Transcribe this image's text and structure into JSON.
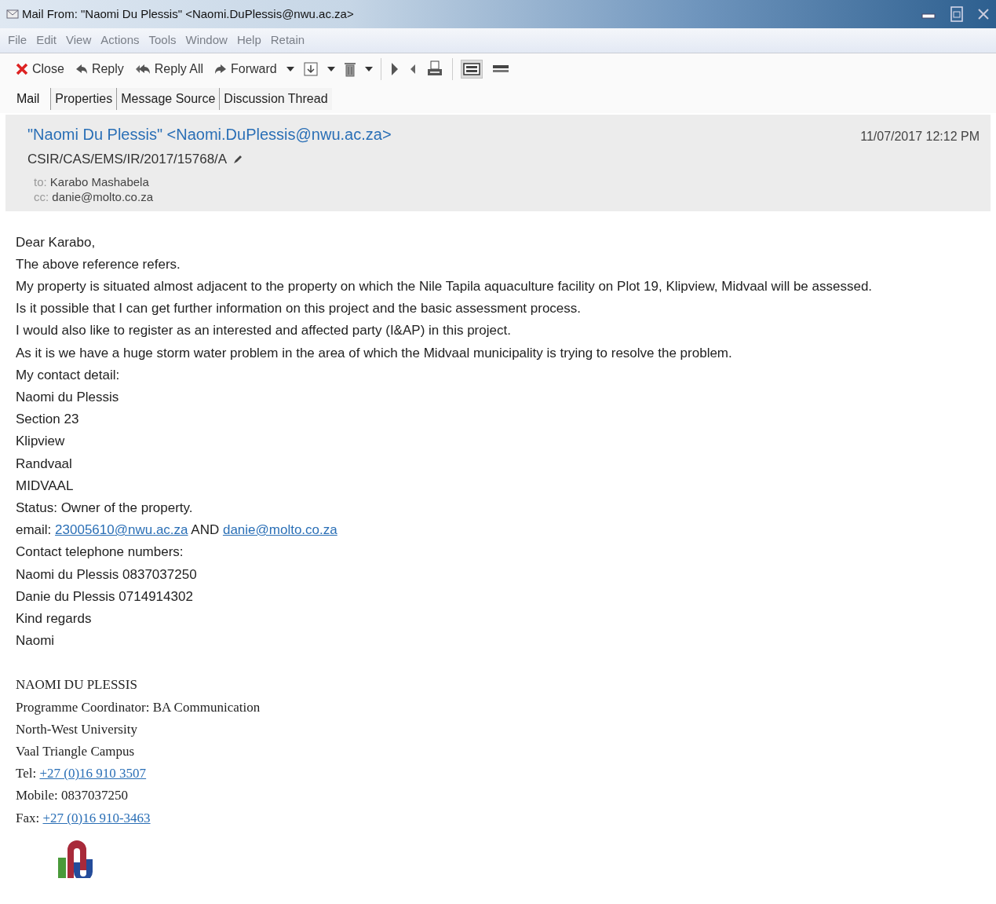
{
  "window": {
    "title": "Mail From: \"Naomi Du Plessis\" <Naomi.DuPlessis@nwu.ac.za>"
  },
  "menu": [
    "File",
    "Edit",
    "View",
    "Actions",
    "Tools",
    "Window",
    "Help",
    "Retain"
  ],
  "toolbar": [
    {
      "kind": "button",
      "label": "Close"
    },
    {
      "kind": "button",
      "label": "Reply"
    },
    {
      "kind": "button",
      "label": "Reply All"
    },
    {
      "kind": "button",
      "label": "Forward"
    },
    {
      "kind": "caret"
    },
    {
      "kind": "button"
    },
    {
      "kind": "caret"
    },
    {
      "kind": "button"
    },
    {
      "kind": "caret"
    },
    {
      "kind": "separator"
    },
    {
      "kind": "button"
    },
    {
      "kind": "button"
    },
    {
      "kind": "button"
    },
    {
      "kind": "separator"
    },
    {
      "kind": "toggle",
      "selected": true
    },
    {
      "kind": "toggle",
      "selected": false
    }
  ],
  "tabs": [
    {
      "label": "Mail",
      "selected": true
    },
    {
      "label": "Properties",
      "selected": false
    },
    {
      "label": "Message Source",
      "selected": false
    },
    {
      "label": "Discussion Thread",
      "selected": false
    }
  ],
  "header": {
    "from": "\"Naomi Du Plessis\" <Naomi.DuPlessis@nwu.ac.za>",
    "subject": "CSIR/CAS/EMS/IR/2017/15768/A",
    "date": "11/07/2017 12:12 PM",
    "to_label": "to:",
    "to": "Karabo Mashabela",
    "cc_label": "cc:",
    "cc": "danie@molto.co.za"
  },
  "body": [
    {
      "kind": "line",
      "parts": [
        {
          "kind": "text",
          "text": "Dear Karabo,"
        }
      ]
    },
    {
      "kind": "line",
      "parts": [
        {
          "kind": "text",
          "text": "The above reference refers."
        }
      ]
    },
    {
      "kind": "line",
      "parts": [
        {
          "kind": "text",
          "text": "My property is situated almost adjacent to the property on which the Nile Tapila aquaculture facility on Plot 19, Klipview, Midvaal will be assessed."
        }
      ]
    },
    {
      "kind": "line",
      "parts": [
        {
          "kind": "text",
          "text": "Is it possible that I can get further information on this project and the basic assessment process."
        }
      ]
    },
    {
      "kind": "line",
      "parts": [
        {
          "kind": "text",
          "text": "I would also like to register as an interested and affected party (I&AP) in this project."
        }
      ]
    },
    {
      "kind": "line",
      "parts": [
        {
          "kind": "text",
          "text": "As it is we have a huge storm water problem in the area of which the Midvaal municipality is trying to resolve the problem."
        }
      ]
    },
    {
      "kind": "line",
      "parts": [
        {
          "kind": "text",
          "text": "My contact detail:"
        }
      ]
    },
    {
      "kind": "line",
      "parts": [
        {
          "kind": "text",
          "text": "Naomi du Plessis"
        }
      ]
    },
    {
      "kind": "line",
      "parts": [
        {
          "kind": "text",
          "text": "Section 23"
        }
      ]
    },
    {
      "kind": "line",
      "parts": [
        {
          "kind": "text",
          "text": "Klipview"
        }
      ]
    },
    {
      "kind": "line",
      "parts": [
        {
          "kind": "text",
          "text": "Randvaal"
        }
      ]
    },
    {
      "kind": "line",
      "parts": [
        {
          "kind": "text",
          "text": "MIDVAAL"
        }
      ]
    },
    {
      "kind": "line",
      "parts": [
        {
          "kind": "text",
          "text": "Status: Owner of the property."
        }
      ]
    },
    {
      "kind": "line",
      "parts": [
        {
          "kind": "text",
          "text": "email: "
        },
        {
          "kind": "link",
          "text": "23005610@nwu.ac.za"
        },
        {
          "kind": "text",
          "text": " AND "
        },
        {
          "kind": "link",
          "text": "danie@molto.co.za"
        }
      ]
    },
    {
      "kind": "line",
      "parts": [
        {
          "kind": "text",
          "text": "Contact telephone numbers:"
        }
      ]
    },
    {
      "kind": "line",
      "parts": [
        {
          "kind": "text",
          "text": "Naomi du Plessis 0837037250"
        }
      ]
    },
    {
      "kind": "line",
      "parts": [
        {
          "kind": "text",
          "text": "Danie du Plessis 0714914302"
        }
      ]
    },
    {
      "kind": "line",
      "parts": [
        {
          "kind": "text",
          "text": "Kind regards"
        }
      ]
    },
    {
      "kind": "line",
      "parts": [
        {
          "kind": "text",
          "text": "Naomi"
        }
      ]
    },
    {
      "kind": "blank"
    },
    {
      "kind": "signature",
      "parts": [
        {
          "kind": "text",
          "text": "NAOMI DU PLESSIS"
        }
      ]
    },
    {
      "kind": "signature",
      "parts": [
        {
          "kind": "text",
          "text": "Programme Coordinator: BA Communication"
        }
      ]
    },
    {
      "kind": "signature",
      "parts": [
        {
          "kind": "text",
          "text": "North-West University"
        }
      ]
    },
    {
      "kind": "signature",
      "parts": [
        {
          "kind": "text",
          "text": "Vaal Triangle Campus"
        }
      ]
    },
    {
      "kind": "signature",
      "parts": [
        {
          "kind": "text",
          "text": "Tel: "
        },
        {
          "kind": "link",
          "text": "+27 (0)16 910 3507"
        }
      ]
    },
    {
      "kind": "signature",
      "parts": [
        {
          "kind": "text",
          "text": "Mobile: 0837037250"
        }
      ]
    },
    {
      "kind": "signature",
      "parts": [
        {
          "kind": "text",
          "text": "Fax: "
        },
        {
          "kind": "link",
          "text": "+27 (0)16 910-3463"
        }
      ]
    },
    {
      "kind": "logo"
    }
  ]
}
